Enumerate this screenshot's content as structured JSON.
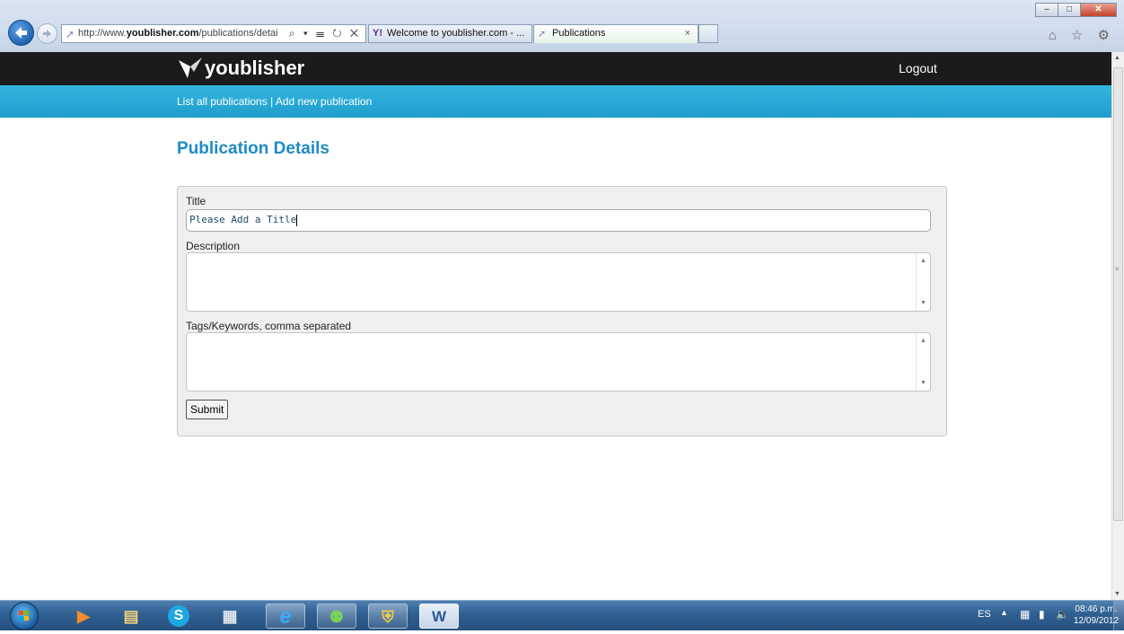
{
  "browser": {
    "address": {
      "url_prefix": "http://www.",
      "url_domain": "youblisher.com",
      "url_path": "/publications/detail:",
      "controls": "⌕ ▾ ☰ ↻ ✕"
    },
    "tabs": [
      {
        "title": "Welcome to youblisher.com - ...",
        "icon": "Y!"
      },
      {
        "title": "Publications",
        "close": "×"
      }
    ],
    "window_buttons": {
      "minimize": "‒",
      "maximize": "□",
      "close": "✕"
    },
    "tool_icons": "⌂ ☆ ⚙"
  },
  "site": {
    "logo_text": "youblisher",
    "logout_label": "Logout",
    "nav": {
      "list_all": "List all publications",
      "separator": " | ",
      "add_new": "Add new publication"
    }
  },
  "page": {
    "title": "Publication Details"
  },
  "form": {
    "title_label": "Title",
    "title_value": "Please Add a Title",
    "description_label": "Description",
    "description_value": "",
    "tags_label": "Tags/Keywords, comma separated",
    "tags_value": "",
    "submit_label": "Submit"
  },
  "taskbar": {
    "apps": [
      {
        "name": "media-player",
        "glyph": "▶"
      },
      {
        "name": "file-explorer",
        "glyph": "▤"
      },
      {
        "name": "skype",
        "glyph": "S"
      },
      {
        "name": "calculator",
        "glyph": "▦"
      },
      {
        "name": "internet-explorer",
        "glyph": "e"
      },
      {
        "name": "people",
        "glyph": "⚉"
      },
      {
        "name": "security-shield",
        "glyph": "⛨"
      },
      {
        "name": "word",
        "glyph": "W"
      }
    ],
    "tray": {
      "language": "ES",
      "time": "08:46 p.m.",
      "date": "12/09/2012"
    }
  },
  "colors": {
    "accent": "#1e8bc3",
    "nav_bar": "#27a9d8",
    "top_bar": "#1b1b1b"
  }
}
